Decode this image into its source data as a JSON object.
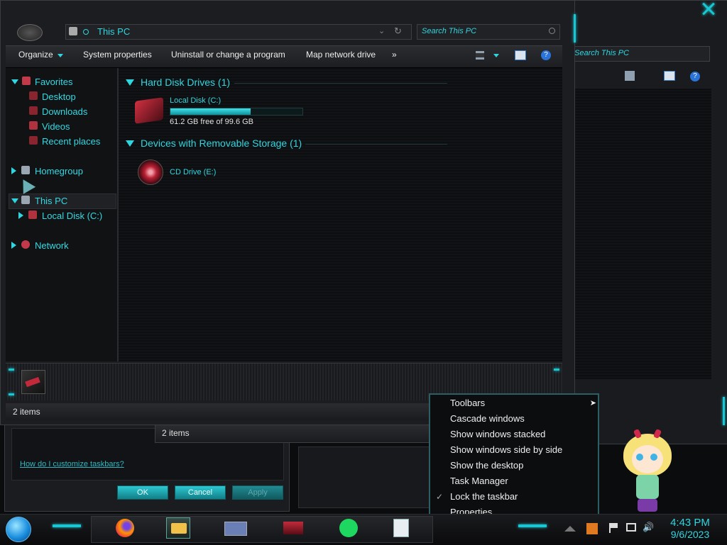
{
  "address_bar": {
    "path": "This PC"
  },
  "search": {
    "placeholder": "Search This PC"
  },
  "command_bar": {
    "organize": "Organize",
    "system_properties": "System properties",
    "uninstall": "Uninstall or change a program",
    "map_drive": "Map network drive",
    "more": "»"
  },
  "nav": {
    "favorites": "Favorites",
    "desktop": "Desktop",
    "downloads": "Downloads",
    "videos": "Videos",
    "recent": "Recent places",
    "homegroup": "Homegroup",
    "this_pc": "This PC",
    "local_disk": "Local Disk (C:)",
    "network": "Network"
  },
  "content": {
    "hdd_group": "Hard Disk Drives (1)",
    "local_disk_name": "Local Disk (C:)",
    "local_disk_space": "61.2 GB free of 99.6 GB",
    "local_disk_free_fraction": 0.61,
    "removable_group": "Devices with Removable Storage (1)",
    "cd_drive": "CD Drive (E:)"
  },
  "status": {
    "items": "2 items",
    "back_items": "2 items"
  },
  "back_window": {
    "search_placeholder": "Search This PC"
  },
  "dialog": {
    "help_link": "How do I customize taskbars?",
    "ok": "OK",
    "cancel": "Cancel",
    "apply": "Apply"
  },
  "context_menu": {
    "toolbars": "Toolbars",
    "cascade": "Cascade windows",
    "stacked": "Show windows stacked",
    "side_by_side": "Show windows side by side",
    "desktop": "Show the desktop",
    "task_manager": "Task Manager",
    "lock": "Lock the taskbar",
    "properties": "Properties"
  },
  "clock": {
    "time": "4:43 PM",
    "date": "9/6/2023"
  },
  "colors": {
    "accent": "#2fd6e0",
    "background": "#0b0c0e"
  }
}
